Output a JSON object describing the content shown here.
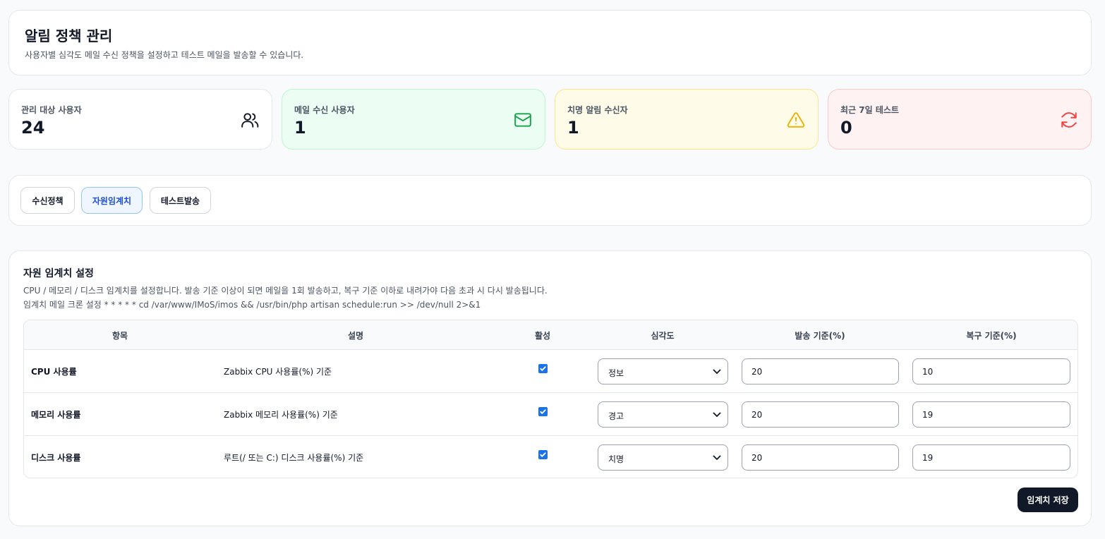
{
  "header": {
    "title": "알림 정책 관리",
    "subtitle": "사용자별 심각도 메일 수신 정책을 설정하고 테스트 메일을 발송할 수 있습니다."
  },
  "stats": [
    {
      "label": "관리 대상 사용자",
      "value": "24",
      "icon": "users-icon",
      "accent": "#111827"
    },
    {
      "label": "메일 수신 사용자",
      "value": "1",
      "icon": "mail-icon",
      "accent": "#16a34a"
    },
    {
      "label": "치명 알림 수신자",
      "value": "1",
      "icon": "warning-icon",
      "accent": "#eab308"
    },
    {
      "label": "최근 7일 테스트",
      "value": "0",
      "icon": "refresh-icon",
      "accent": "#ef4444"
    }
  ],
  "tabs": [
    {
      "label": "수신정책",
      "active": false
    },
    {
      "label": "자원임계치",
      "active": true
    },
    {
      "label": "테스트발송",
      "active": false
    }
  ],
  "panel": {
    "title": "자원 임계치 설정",
    "description": "CPU / 메모리 / 디스크 임계치를 설정합니다. 발송 기준 이상이 되면 메일을 1회 발송하고, 복구 기준 이하로 내려가야 다음 초과 시 다시 발송됩니다.",
    "cron": "임계치 메일 크론 설정 * * * * * cd /var/www/IMoS/imos && /usr/bin/php artisan schedule:run >> /dev/null 2>&1",
    "columns": [
      "항목",
      "설명",
      "활성",
      "심각도",
      "발송 기준(%)",
      "복구 기준(%)"
    ],
    "rows": [
      {
        "name": "CPU 사용률",
        "description": "Zabbix CPU 사용률(%) 기준",
        "enabled": true,
        "severity": "정보",
        "send": "20",
        "recover": "10"
      },
      {
        "name": "메모리 사용률",
        "description": "Zabbix 메모리 사용률(%) 기준",
        "enabled": true,
        "severity": "경고",
        "send": "20",
        "recover": "19"
      },
      {
        "name": "디스크 사용률",
        "description": "루트(/ 또는 C:) 디스크 사용률(%) 기준",
        "enabled": true,
        "severity": "치명",
        "send": "20",
        "recover": "19"
      }
    ],
    "save_label": "임계치 저장"
  }
}
